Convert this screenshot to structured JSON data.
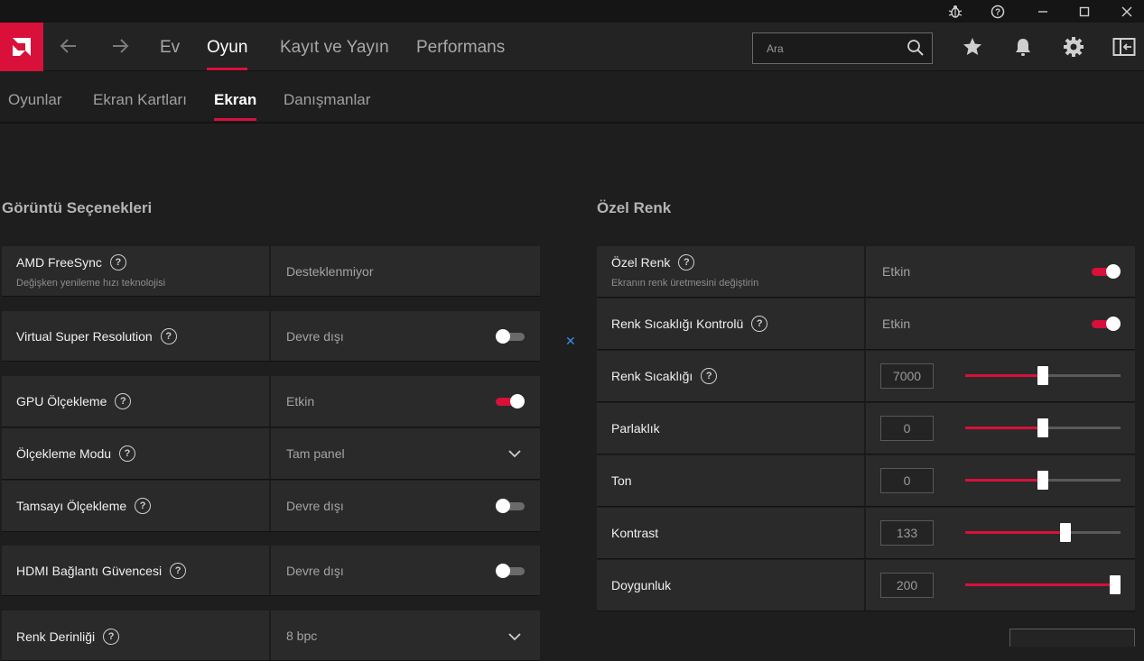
{
  "topnav": {
    "tabs": [
      {
        "label": "Ev"
      },
      {
        "label": "Oyun"
      },
      {
        "label": "Kayıt ve Yayın"
      },
      {
        "label": "Performans"
      }
    ],
    "search_placeholder": "Ara"
  },
  "subnav": {
    "tabs": [
      {
        "label": "Oyunlar"
      },
      {
        "label": "Ekran Kartları"
      },
      {
        "label": "Ekran"
      },
      {
        "label": "Danışmanlar"
      }
    ]
  },
  "left": {
    "title": "Görüntü Seçenekleri",
    "rows": [
      {
        "label": "AMD FreeSync",
        "sub": "Değişken yenileme hızı teknolojisi",
        "value": "Desteklenmiyor"
      },
      {
        "label": "Virtual Super Resolution",
        "value": "Devre dışı",
        "toggle": "off"
      },
      {
        "label": "GPU Ölçekleme",
        "value": "Etkin",
        "toggle": "on"
      },
      {
        "label": "Ölçekleme Modu",
        "value": "Tam panel"
      },
      {
        "label": "Tamsayı Ölçekleme",
        "value": "Devre dışı",
        "toggle": "off"
      },
      {
        "label": "HDMI Bağlantı Güvencesi",
        "value": "Devre dışı",
        "toggle": "off"
      },
      {
        "label": "Renk Derinliği",
        "value": "8 bpc"
      }
    ]
  },
  "right": {
    "title": "Özel Renk",
    "rows": [
      {
        "label": "Özel Renk",
        "sub": "Ekranın renk üretmesini değiştirin",
        "value": "Etkin",
        "toggle": "on"
      },
      {
        "label": "Renk Sıcaklığı Kontrolü",
        "value": "Etkin",
        "toggle": "on"
      },
      {
        "label": "Renk Sıcaklığı",
        "value": "7000",
        "slider_fraction": 0.5
      },
      {
        "label": "Parlaklık",
        "value": "0",
        "slider_fraction": 0.5
      },
      {
        "label": "Ton",
        "value": "0",
        "slider_fraction": 0.5
      },
      {
        "label": "Kontrast",
        "value": "133",
        "slider_fraction": 0.655
      },
      {
        "label": "Doygunluk",
        "value": "200",
        "slider_fraction": 1.0
      }
    ]
  },
  "colors": {
    "accent": "#d8103a",
    "background": "#1e1e1e",
    "card": "#2a2a2a"
  }
}
